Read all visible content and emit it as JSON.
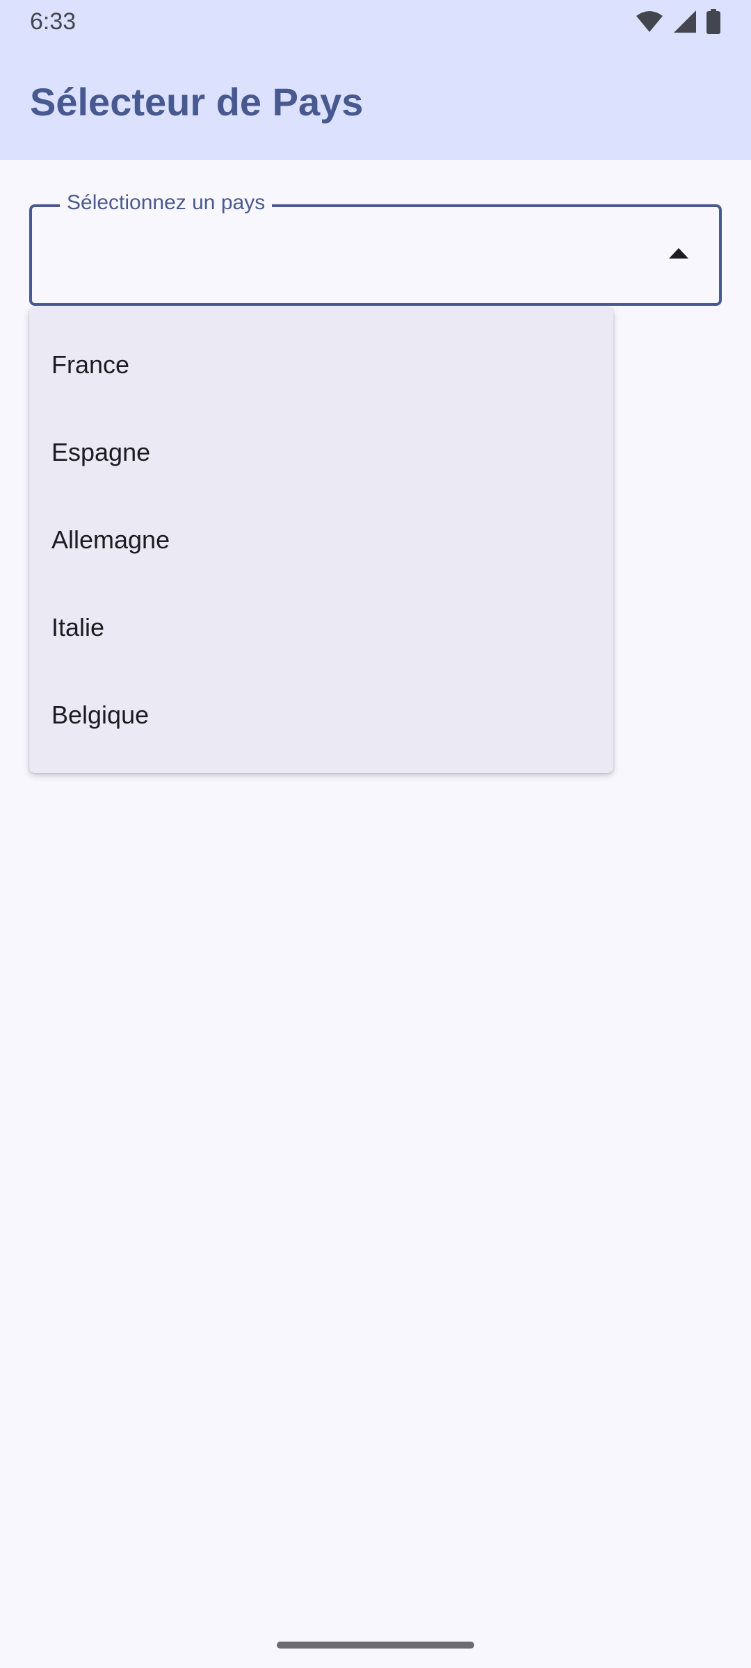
{
  "status_bar": {
    "time": "6:33",
    "icons": [
      "wifi-icon",
      "signal-icon",
      "battery-icon"
    ]
  },
  "app_bar": {
    "title": "Sélecteur de Pays"
  },
  "country_field": {
    "label": "Sélectionnez un pays",
    "value": "",
    "expanded": true
  },
  "menu": {
    "items": [
      "France",
      "Espagne",
      "Allemagne",
      "Italie",
      "Belgique"
    ]
  },
  "colors": {
    "top_bar": "#dce1fd",
    "accent": "#4a5a8f",
    "background": "#f8f7fe",
    "menu_bg": "#ebeaf4"
  }
}
